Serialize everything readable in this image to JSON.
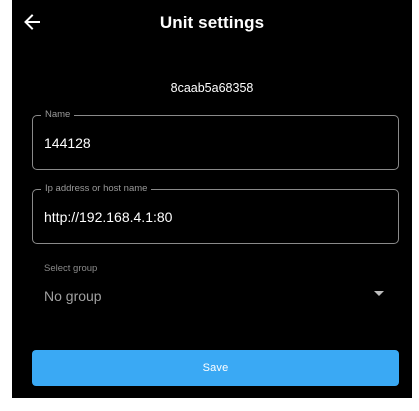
{
  "header": {
    "title": "Unit settings",
    "back_icon": "arrow-left-icon"
  },
  "unit": {
    "id": "8caab5a68358"
  },
  "form": {
    "name": {
      "label": "Name",
      "value": "144128"
    },
    "address": {
      "label": "Ip address or host name",
      "value": "http://192.168.4.1:80"
    },
    "group": {
      "label": "Select group",
      "value": "No group",
      "arrow_icon": "dropdown-arrow-icon"
    },
    "save_label": "Save"
  },
  "colors": {
    "background": "#000000",
    "accent": "#3aa9f4",
    "field_border": "#8a8a8a",
    "label": "#9a9a9a"
  }
}
